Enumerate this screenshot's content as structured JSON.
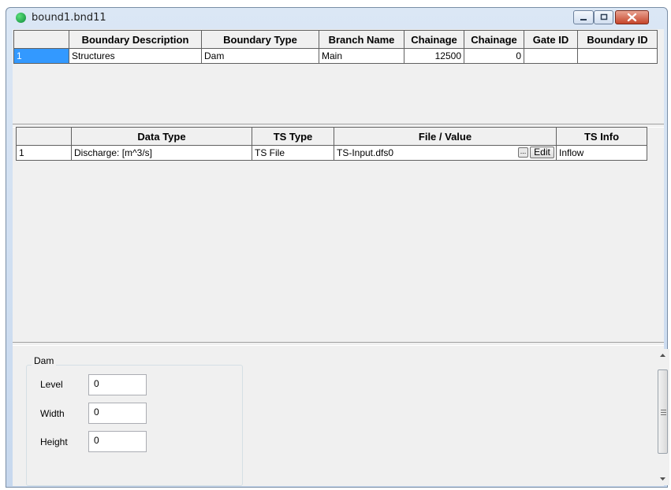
{
  "window": {
    "title": "bound1.bnd11",
    "controls": {
      "minimize_icon": "minimize-icon",
      "maximize_icon": "maximize-icon",
      "close_icon": "close-icon"
    }
  },
  "boundary_grid": {
    "columns": [
      "",
      "Boundary Description",
      "Boundary Type",
      "Branch Name",
      "Chainage",
      "Chainage",
      "Gate ID",
      "Boundary ID"
    ],
    "rows": [
      {
        "index": "1",
        "description": "Structures",
        "type": "Dam",
        "branch": "Main",
        "chainage1": "12500",
        "chainage2": "0",
        "gate_id": "",
        "boundary_id": ""
      }
    ]
  },
  "timeseries_grid": {
    "columns": [
      "",
      "Data Type",
      "TS Type",
      "File / Value",
      "TS Info"
    ],
    "rows": [
      {
        "index": "1",
        "data_type": "Discharge: [m^3/s]",
        "ts_type": "TS File",
        "file_value": "TS-Input.dfs0",
        "browse_label": "...",
        "edit_label": "Edit",
        "ts_info": "Inflow"
      }
    ]
  },
  "dam_panel": {
    "group_title": "Dam",
    "fields": [
      {
        "label": "Level",
        "value": "0"
      },
      {
        "label": "Width",
        "value": "0"
      },
      {
        "label": "Height",
        "value": "0"
      }
    ]
  },
  "colors": {
    "selection": "#3399ff",
    "close_button": "#c6452b",
    "status_dot": "#0e8a3a"
  }
}
